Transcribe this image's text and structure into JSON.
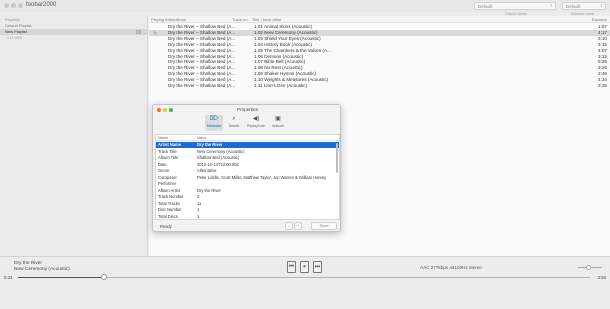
{
  "window": {
    "title": "foobar2000"
  },
  "toolbar": {
    "output_device": "Default",
    "output_device_caption": "Output Device",
    "advance_mode": "Default",
    "advance_caption": "Advance mode"
  },
  "sidebar": {
    "header": "Playlists",
    "items": [
      {
        "label": "Default Playlist",
        "selected": false
      },
      {
        "label": "New Playlist",
        "selected": true,
        "sub": "1:12:44:5"
      }
    ]
  },
  "playlist": {
    "columns": {
      "playing_artist": "Playing  Artist/album",
      "track_no": "Track no",
      "title": "Title / track artist",
      "duration": "Duration"
    },
    "rows": [
      {
        "artist": "Dry the River – Shallow Bed (A...",
        "track": "1.01  Animal Skins (Acoustic)",
        "duration": "1:07",
        "playing": false,
        "selected": false
      },
      {
        "artist": "Dry the River – Shallow Bed (A...",
        "track": "1.02  New Ceremony (Acoustic)",
        "duration": "4:17",
        "playing": true,
        "selected": true
      },
      {
        "artist": "Dry the River – Shallow Bed (A...",
        "track": "1.03  Shield Your Eyes (Acoustic)",
        "duration": "3:10",
        "playing": false,
        "selected": false
      },
      {
        "artist": "Dry the River – Shallow Bed (A...",
        "track": "1.04  History Book (Acoustic)",
        "duration": "3:15",
        "playing": false,
        "selected": false
      },
      {
        "artist": "Dry the River – Shallow Bed (A...",
        "track": "1.05  The Chambers & the Valves (A...",
        "duration": "4:07",
        "playing": false,
        "selected": false
      },
      {
        "artist": "Dry the River – Shallow Bed (A...",
        "track": "1.06  Demons (Acoustic)",
        "duration": "3:15",
        "playing": false,
        "selected": false
      },
      {
        "artist": "Dry the River – Shallow Bed (A...",
        "track": "1.07  Bible Belt (Acoustic)",
        "duration": "5:26",
        "playing": false,
        "selected": false
      },
      {
        "artist": "Dry the River – Shallow Bed (A...",
        "track": "1.08  No Rest (Acoustic)",
        "duration": "3:26",
        "playing": false,
        "selected": false
      },
      {
        "artist": "Dry the River – Shallow Bed (A...",
        "track": "1.09  Shaker Hymns (Acoustic)",
        "duration": "3:49",
        "playing": false,
        "selected": false
      },
      {
        "artist": "Dry the River – Shallow Bed (A...",
        "track": "1.10  Weights & Measures (Acoustic)",
        "duration": "4:34",
        "playing": false,
        "selected": false
      },
      {
        "artist": "Dry the River – Shallow Bed (A...",
        "track": "1.11  Lion's Den (Acoustic)",
        "duration": "3:35",
        "playing": false,
        "selected": false
      }
    ]
  },
  "properties": {
    "title": "Properties",
    "tabs": [
      {
        "label": "Metadata",
        "icon": "tag-icon",
        "active": true
      },
      {
        "label": "Details",
        "icon": "search-icon",
        "active": false
      },
      {
        "label": "ReplayGain",
        "icon": "speaker-icon",
        "active": false
      },
      {
        "label": "Artwork",
        "icon": "image-icon",
        "active": false
      }
    ],
    "columns": {
      "name": "Name",
      "value": "Value"
    },
    "rows": [
      {
        "name": "Artist Name",
        "value": "Dry the River",
        "selected": true
      },
      {
        "name": "Track Title",
        "value": "New Ceremony (Acoustic)",
        "selected": false
      },
      {
        "name": "Album Title",
        "value": "Shallow Bed (Acoustic)",
        "selected": false
      },
      {
        "name": "Date",
        "value": "2012-12-14T12:00:00Z",
        "selected": false
      },
      {
        "name": "Genre",
        "value": "Alternative",
        "selected": false
      },
      {
        "name": "Composer",
        "value": "Peter Liddle, Scott Miller, Matthew Taylor, Jon Warren & William Harvey",
        "selected": false
      },
      {
        "name": "Performer",
        "value": "",
        "selected": false
      },
      {
        "name": "Album Artist",
        "value": "Dry the River",
        "selected": false
      },
      {
        "name": "Track Number",
        "value": "2",
        "selected": false
      },
      {
        "name": "Total Tracks",
        "value": "11",
        "selected": false
      },
      {
        "name": "Disc Number",
        "value": "1",
        "selected": false
      },
      {
        "name": "Total Discs",
        "value": "1",
        "selected": false
      }
    ],
    "status": "Ready",
    "stepper_minus": "–",
    "stepper_plus": "+",
    "apply_label": "Save"
  },
  "now_playing": {
    "artist": "Dry the River",
    "track": "New Ceremony (Acoustic)",
    "tech_info": "AAC 277kbps 44100Hz stereo",
    "time_elapsed": "0:34",
    "time_total": "3:50",
    "progress": 0.15,
    "volume": 0.45,
    "controls": {
      "prev": "⏮",
      "pause": "⏸",
      "next": "⏭"
    }
  }
}
